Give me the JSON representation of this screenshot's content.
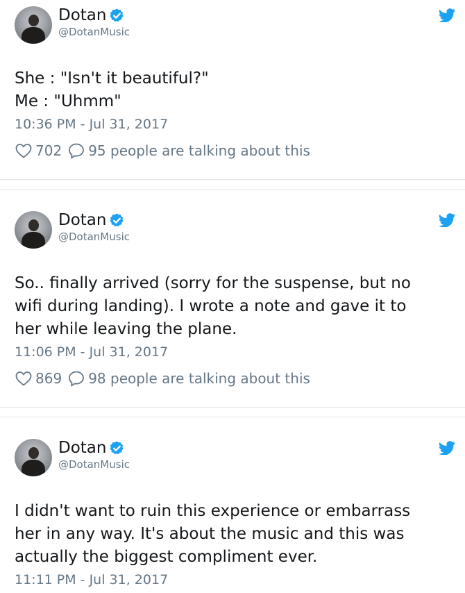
{
  "tweets": [
    {
      "name": "Dotan",
      "handle": "@DotanMusic",
      "text": "She : \"Isn't it beautiful?\"\nMe : \"Uhmm\"",
      "time": "10:36 PM - Jul 31, 2017",
      "likes": "702",
      "talking": "95 people are talking about this"
    },
    {
      "name": "Dotan",
      "handle": "@DotanMusic",
      "text": "So.. finally arrived (sorry for the suspense, but no\nwifi during landing). I wrote a note and gave it to\nher while leaving the plane.",
      "time": "11:06 PM - Jul 31, 2017",
      "likes": "869",
      "talking": "98 people are talking about this"
    },
    {
      "name": "Dotan",
      "handle": "@DotanMusic",
      "text": "I didn't want to ruin this experience or embarrass\nher in any way. It's about the music and this was\nactually the biggest compliment ever.",
      "time": "11:11 PM - Jul 31, 2017"
    }
  ],
  "colors": {
    "twitter_blue": "#1da1f2",
    "secondary_text": "#657786",
    "divider": "#e1e8ed"
  },
  "icons": [
    "verified-badge-icon",
    "twitter-bird-icon",
    "heart-icon",
    "reply-bubble-icon"
  ]
}
